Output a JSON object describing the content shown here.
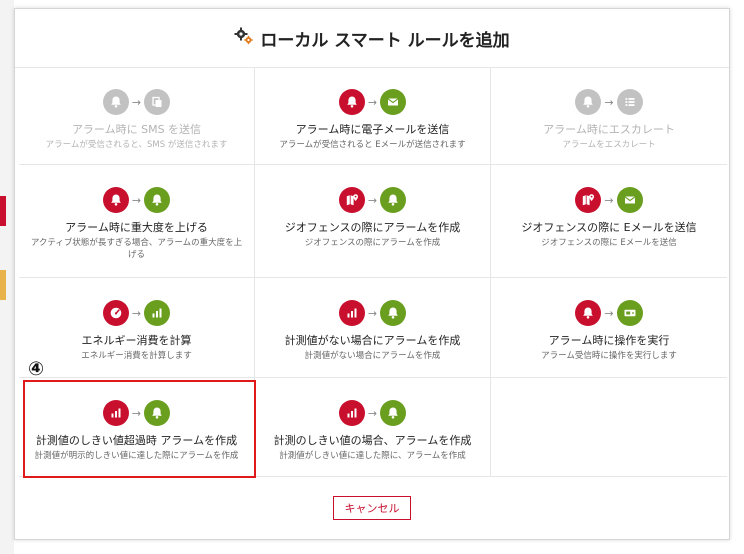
{
  "dialog": {
    "title": "ローカル スマート ルールを追加",
    "title_icon": "gears-icon"
  },
  "colors": {
    "red": "#c8102e",
    "green": "#6a9e1f",
    "disabled": "#c2c2c2",
    "highlight": "#e01a1a"
  },
  "rules": [
    {
      "title": "アラーム時に SMS を送信",
      "desc": "アラームが受信されると、SMS が送信されます",
      "left_icon": "bell-icon",
      "left_color": "disabled",
      "right_icon": "copy-icon",
      "right_color": "disabled",
      "disabled": true
    },
    {
      "title": "アラーム時に電子メールを送信",
      "desc": "アラームが受信されると Eメールが送信されます",
      "left_icon": "bell-icon",
      "left_color": "red",
      "right_icon": "envelope-icon",
      "right_color": "green",
      "disabled": false
    },
    {
      "title": "アラーム時にエスカレート",
      "desc": "アラームをエスカレート",
      "left_icon": "bell-icon",
      "left_color": "disabled",
      "right_icon": "list-icon",
      "right_color": "disabled",
      "disabled": true
    },
    {
      "title": "アラーム時に重大度を上げる",
      "desc": "アクティブ状態が長すぎる場合、アラームの重大度を上げる",
      "left_icon": "bell-icon",
      "left_color": "red",
      "right_icon": "bell-icon",
      "right_color": "green",
      "disabled": false
    },
    {
      "title": "ジオフェンスの際にアラームを作成",
      "desc": "ジオフェンスの際にアラームを作成",
      "left_icon": "map-pin-icon",
      "left_color": "red",
      "right_icon": "bell-icon",
      "right_color": "green",
      "disabled": false
    },
    {
      "title": "ジオフェンスの際に Eメールを送信",
      "desc": "ジオフェンスの際に Eメールを送信",
      "left_icon": "map-pin-icon",
      "left_color": "red",
      "right_icon": "envelope-icon",
      "right_color": "green",
      "disabled": false
    },
    {
      "title": "エネルギー消費を計算",
      "desc": "エネルギー消費を計算します",
      "left_icon": "gauge-icon",
      "left_color": "red",
      "right_icon": "bar-chart-icon",
      "right_color": "green",
      "disabled": false
    },
    {
      "title": "計測値がない場合にアラームを作成",
      "desc": "計測値がない場合にアラームを作成",
      "left_icon": "bar-chart-icon",
      "left_color": "red",
      "right_icon": "bell-icon",
      "right_color": "green",
      "disabled": false
    },
    {
      "title": "アラーム時に操作を実行",
      "desc": "アラーム受信時に操作を実行します",
      "left_icon": "bell-icon",
      "left_color": "red",
      "right_icon": "device-icon",
      "right_color": "green",
      "disabled": false
    },
    {
      "title": "計測値のしきい値超過時 アラームを作成",
      "desc": "計測値が明示的しきい値に達した際にアラームを作成",
      "left_icon": "bar-chart-icon",
      "left_color": "red",
      "right_icon": "bell-icon",
      "right_color": "green",
      "disabled": false
    },
    {
      "title": "計測のしきい値の場合、アラームを作成",
      "desc": "計測値がしきい値に達した際に、アラームを作成",
      "left_icon": "bar-chart-icon",
      "left_color": "red",
      "right_icon": "bell-icon",
      "right_color": "green",
      "disabled": false
    }
  ],
  "arrow": "→",
  "annotation": {
    "marker": "④"
  },
  "cancel_label": "キャンセル"
}
